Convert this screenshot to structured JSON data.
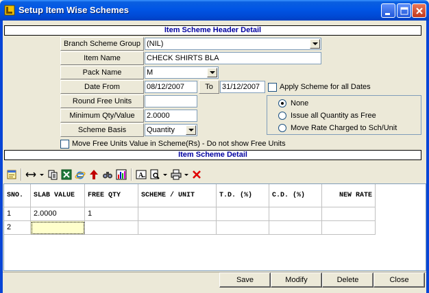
{
  "window": {
    "title": "Setup Item Wise Schemes"
  },
  "header_section": {
    "title": "Item Scheme Header Detail"
  },
  "fields": {
    "branch_scheme_group": {
      "label": "Branch Scheme Group",
      "value": "(NIL)"
    },
    "item_name": {
      "label": "Item Name",
      "value": "CHECK SHIRTS BLA"
    },
    "pack_name": {
      "label": "Pack Name",
      "value": "M"
    },
    "date_from": {
      "label": "Date From",
      "value": "08/12/2007"
    },
    "date_to_label": "To",
    "date_to": {
      "value": "31/12/2007"
    },
    "apply_all_dates": {
      "label": "Apply Scheme for all Dates",
      "checked": false
    },
    "round_free_units": {
      "label": "Round Free Units",
      "value": ""
    },
    "min_qty_value": {
      "label": "Minimum Qty/Value",
      "value": "2.0000"
    },
    "scheme_basis": {
      "label": "Scheme Basis",
      "value": "Quantity"
    },
    "move_free_units": {
      "label": "Move Free Units Value in Scheme(Rs) - Do not show Free Units",
      "checked": false
    }
  },
  "options": {
    "selected": "None",
    "items": [
      "None",
      "Issue all Quantity as Free",
      "Move Rate Charged to Sch/Unit"
    ]
  },
  "detail_section": {
    "title": "Item Scheme Detail"
  },
  "toolbar_icons": [
    "properties-icon",
    "resize-columns-icon",
    "copy-icon",
    "excel-icon",
    "internet-explorer-icon",
    "up-arrow-icon",
    "find-icon",
    "chart-icon",
    "text-icon",
    "print-preview-icon",
    "print-icon",
    "delete-icon"
  ],
  "grid": {
    "columns": [
      "SNO.",
      "SLAB VALUE",
      "FREE QTY",
      "SCHEME / UNIT",
      "T.D. (%)",
      "C.D. (%)",
      "NEW RATE"
    ],
    "rows": [
      [
        "1",
        "2.0000",
        "1",
        "",
        "",
        "",
        ""
      ],
      [
        "2",
        "",
        "",
        "",
        "",
        "",
        ""
      ]
    ]
  },
  "buttons": {
    "save": "Save",
    "modify": "Modify",
    "delete": "Delete",
    "close": "Close"
  },
  "colors": {
    "title_bar": "#0055e5",
    "section_title": "#0000a0",
    "selected_cell": "#ffffcc"
  }
}
